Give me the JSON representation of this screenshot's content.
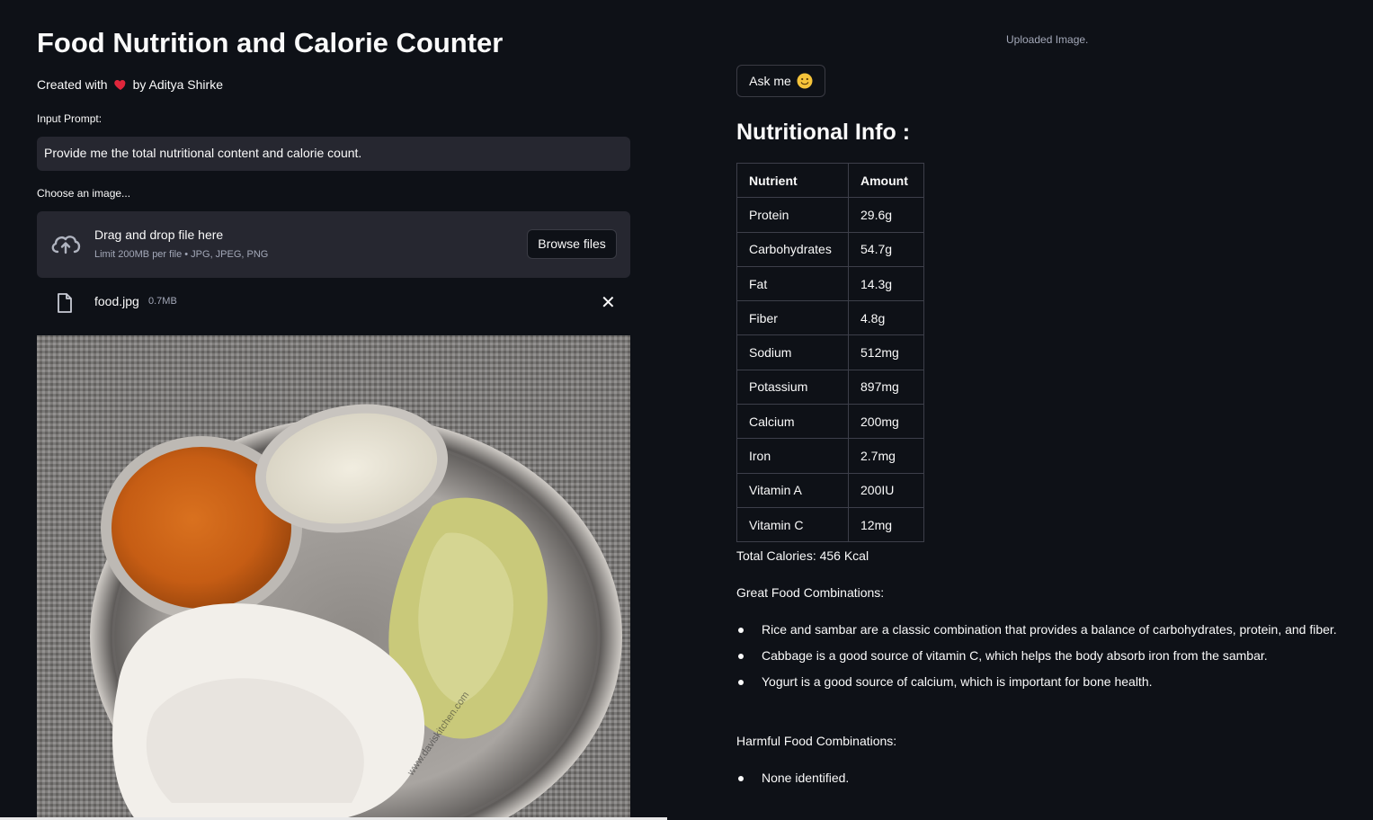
{
  "header": {
    "title": "Food Nutrition and Calorie Counter",
    "credit_prefix": "Created with",
    "credit_suffix": "by Aditya Shirke"
  },
  "prompt": {
    "label": "Input Prompt:",
    "value": "Provide me the total nutritional content and calorie count."
  },
  "uploader": {
    "label": "Choose an image...",
    "drop_text": "Drag and drop file here",
    "limit_text": "Limit 200MB per file • JPG, JPEG, PNG",
    "browse_label": "Browse files"
  },
  "file": {
    "name": "food.jpg",
    "size": "0.7MB",
    "remove_label": "✕"
  },
  "image": {
    "caption": "Uploaded Image.",
    "watermark": "www.daviskitchen.com"
  },
  "ask_button": {
    "label": "Ask me"
  },
  "nutrition": {
    "heading": "Nutritional Info :",
    "columns": [
      "Nutrient",
      "Amount"
    ],
    "rows": [
      [
        "Protein",
        "29.6g"
      ],
      [
        "Carbohydrates",
        "54.7g"
      ],
      [
        "Fat",
        "14.3g"
      ],
      [
        "Fiber",
        "4.8g"
      ],
      [
        "Sodium",
        "512mg"
      ],
      [
        "Potassium",
        "897mg"
      ],
      [
        "Calcium",
        "200mg"
      ],
      [
        "Iron",
        "2.7mg"
      ],
      [
        "Vitamin A",
        "200IU"
      ],
      [
        "Vitamin C",
        "12mg"
      ]
    ],
    "total_calories": "Total Calories: 456 Kcal",
    "great_heading": "Great Food Combinations:",
    "great_items": [
      "Rice and sambar are a classic combination that provides a balance of carbohydrates, protein, and fiber.",
      "Cabbage is a good source of vitamin C, which helps the body absorb iron from the sambar.",
      "Yogurt is a good source of calcium, which is important for bone health."
    ],
    "harmful_heading": "Harmful Food Combinations:",
    "harmful_items": [
      "None identified."
    ]
  },
  "icons": {
    "heart": "heart-icon",
    "upload": "cloud-upload-icon",
    "file": "file-icon",
    "close": "close-icon",
    "smile": "smile-emoji-icon"
  },
  "colors": {
    "background": "#0e1117",
    "input_background": "#262730",
    "text": "#fafafa",
    "muted": "#a3a8b8",
    "heart": "#e0263b"
  }
}
